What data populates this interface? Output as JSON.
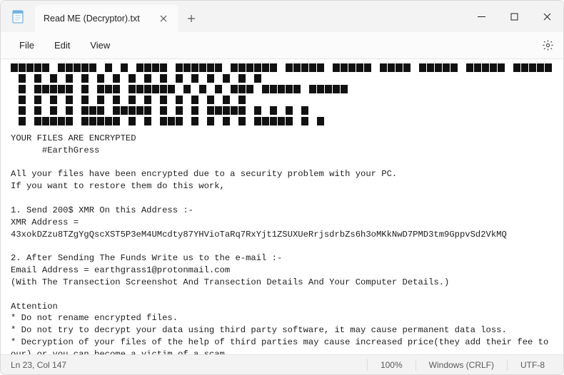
{
  "titlebar": {
    "tab_title": "Read ME (Decryptor).txt"
  },
  "menubar": {
    "file": "File",
    "edit": "Edit",
    "view": "View"
  },
  "note": {
    "heading1": "YOUR FILES ARE ENCRYPTED",
    "heading2": "      #EarthGress",
    "para1_l1": "All your files have been encrypted due to a security problem with your PC.",
    "para1_l2": "If you want to restore them do this work,",
    "step1_title": "1. Send 200$ XMR On this Address :-",
    "step1_l1": "XMR Address =",
    "step1_l2": "43xokDZzu8TZgYgQscXST5P3eM4UMcdty87YHVioTaRq7RxYjt1ZSUXUeRrjsdrbZs6h3oMKkNwD7PMD3tm9GppvSd2VkMQ",
    "step2_title": "2. After Sending The Funds Write us to the e-mail :-",
    "step2_l1": "Email Address = earthgrass1@protonmail.com",
    "step2_l2": "(With The Transection Screenshot And Transection Details And Your Computer Details.)",
    "attn": "Attention",
    "attn_l1": "* Do not rename encrypted files.",
    "attn_l2": "* Do not try to decrypt your data using third party software, it may cause permanent data loss.",
    "attn_l3": "* Decryption of your files of the help of third parties may cause increased price(they add their fee to our) or you can become a victim of a scam."
  },
  "statusbar": {
    "pos": "Ln 23, Col 147",
    "zoom": "100%",
    "crlf": "Windows (CRLF)",
    "encoding": "UTF-8"
  }
}
